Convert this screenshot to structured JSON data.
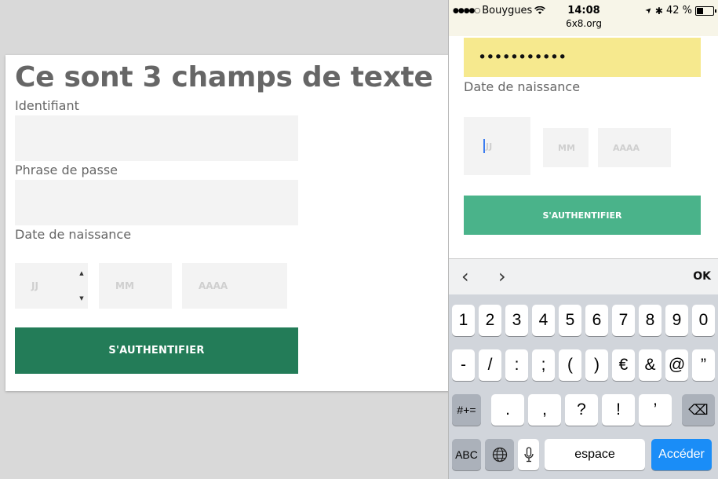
{
  "desktop": {
    "title": "Ce sont 3 champs de texte",
    "identifier_label": "Identifiant",
    "passphrase_label": "Phrase de passe",
    "birthdate_label": "Date de naissance",
    "day_placeholder": "JJ",
    "month_placeholder": "MM",
    "year_placeholder": "AAAA",
    "spin_up": "▲",
    "spin_down": "▼",
    "submit_label": "S'AUTHENTIFIER"
  },
  "phone": {
    "status": {
      "signal": "●●●●○",
      "carrier": "Bouygues",
      "wifi": "wifi-icon",
      "time": "14:08",
      "location": "➤",
      "bluetooth": "✱",
      "battery_text": "42 %",
      "battery_level": 0.42
    },
    "url": "6x8.org",
    "password_value": "•••••••••••",
    "birthdate_label": "Date de naissance",
    "day_placeholder": "JJ",
    "month_placeholder": "MM",
    "year_placeholder": "AAAA",
    "submit_label": "S'AUTHENTIFIER",
    "accessory": {
      "prev": "‹",
      "next": "›",
      "ok": "OK"
    },
    "keyboard": {
      "row1": [
        "1",
        "2",
        "3",
        "4",
        "5",
        "6",
        "7",
        "8",
        "9",
        "0"
      ],
      "row2": [
        "-",
        "/",
        ":",
        ";",
        "(",
        ")",
        "€",
        "&",
        "@",
        "”"
      ],
      "row3_left": "#+=",
      "row3": [
        ".",
        ",",
        "?",
        "!",
        "’"
      ],
      "delete": "⌫",
      "abc": "ABC",
      "globe": "globe-icon",
      "mic": "microphone-icon",
      "space": "espace",
      "go": "Accéder"
    }
  },
  "colors": {
    "accent_dark": "#237c58",
    "accent_light": "#4ab38a",
    "autofill": "#f6e98e",
    "ios_blue": "#1a8df7"
  }
}
